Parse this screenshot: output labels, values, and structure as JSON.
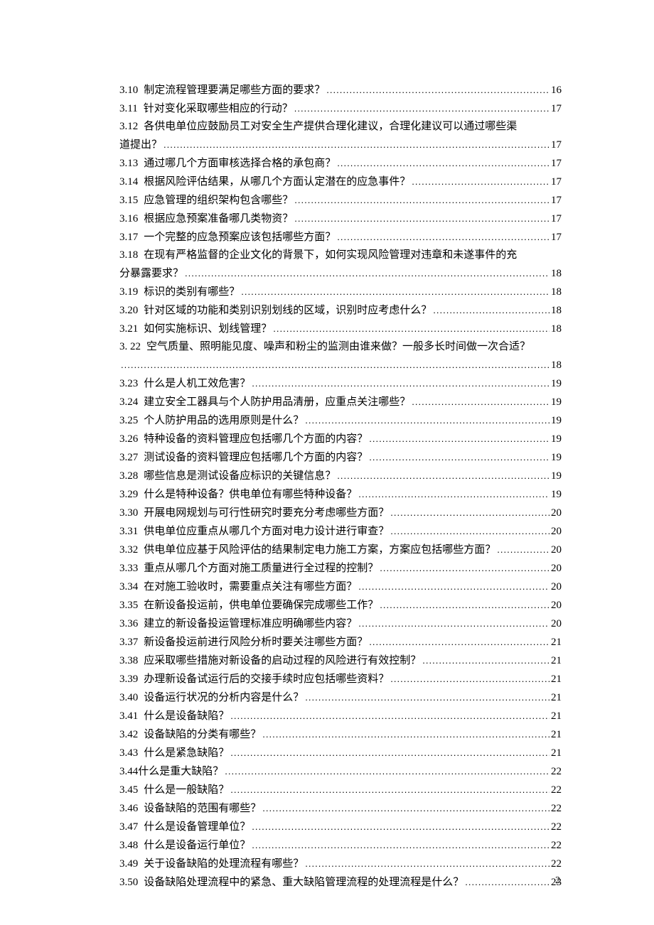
{
  "page_number": "2",
  "entries": [
    {
      "num": "3.10",
      "title": "制定流程管理要满足哪些方面的要求？",
      "page": "16",
      "wrap": false
    },
    {
      "num": "3.11",
      "title": "针对变化采取哪些相应的行动？",
      "page": "17",
      "wrap": false
    },
    {
      "num": "3.12",
      "title_line1": "各供电单位应鼓励员工对安全生产提供合理化建议，合理化建议可以通过哪些渠",
      "title_line2": "道提出？",
      "page": "17",
      "wrap": true
    },
    {
      "num": "3.13",
      "title": "通过哪几个方面审核选择合格的承包商？",
      "page": "17",
      "wrap": false
    },
    {
      "num": "3.14",
      "title": "根据风险评估结果，从哪几个方面认定潜在的应急事件？",
      "page": "17",
      "wrap": false
    },
    {
      "num": "3.15",
      "title": "应急管理的组织架构包含哪些？",
      "page": "17",
      "wrap": false
    },
    {
      "num": "3.16",
      "title": "根据应急预案准备哪几类物资？",
      "page": "17",
      "wrap": false
    },
    {
      "num": "3.17",
      "title": "一个完整的应急预案应该包括哪些方面？",
      "page": "17",
      "wrap": false
    },
    {
      "num": "3.18",
      "title_line1": "在现有严格监督的企业文化的背景下，如何实现风险管理对违章和未遂事件的充",
      "title_line2": "分暴露要求？",
      "page": "18",
      "wrap": true
    },
    {
      "num": "3.19",
      "title": "标识的类别有哪些？",
      "page": "18",
      "wrap": false
    },
    {
      "num": "3.20",
      "title": "针对区域的功能和类别识别划线的区域，识别时应考虑什么？",
      "page": "18",
      "wrap": false
    },
    {
      "num": "3.21",
      "title": "如何实施标识、划线管理？",
      "page": "18",
      "wrap": false
    },
    {
      "num": "3. 22",
      "title_line1": "空气质量、照明能见度、噪声和粉尘的监测由谁来做？一般多长时间做一次合适？",
      "title_line2": "",
      "page": "18",
      "wrap": true
    },
    {
      "num": "3.23",
      "title": "什么是人机工效危害？",
      "page": "19",
      "wrap": false
    },
    {
      "num": "3.24",
      "title": "建立安全工器具与个人防护用品清册，应重点关注哪些？",
      "page": "19",
      "wrap": false
    },
    {
      "num": "3.25",
      "title": "个人防护用品的选用原则是什么？",
      "page": "19",
      "wrap": false
    },
    {
      "num": "3.26",
      "title": "特种设备的资料管理应包括哪几个方面的内容？",
      "page": "19",
      "wrap": false
    },
    {
      "num": "3.27",
      "title": "测试设备的资料管理应包括哪几个方面的内容？",
      "page": "19",
      "wrap": false
    },
    {
      "num": "3.28",
      "title": "哪些信息是测试设备应标识的关键信息？",
      "page": "19",
      "wrap": false
    },
    {
      "num": "3.29",
      "title": "什么是特种设备？供电单位有哪些特种设备？",
      "page": "19",
      "wrap": false
    },
    {
      "num": "3.30",
      "title": "开展电网规划与可行性研究时要充分考虑哪些方面？",
      "page": "20",
      "wrap": false
    },
    {
      "num": "3.31",
      "title": "供电单位应重点从哪几个方面对电力设计进行审查？",
      "page": "20",
      "wrap": false
    },
    {
      "num": "3.32",
      "title": "供电单位应基于风险评估的结果制定电力施工方案，方案应包括哪些方面？",
      "page": "20",
      "wrap": false,
      "tight": true
    },
    {
      "num": "3.33",
      "title": "重点从哪几个方面对施工质量进行全过程的控制？",
      "page": "20",
      "wrap": false
    },
    {
      "num": "3.34",
      "title": "在对施工验收时，需要重点关注有哪些方面？",
      "page": "20",
      "wrap": false
    },
    {
      "num": "3.35",
      "title": "在新设备投运前，供电单位要确保完成哪些工作？",
      "page": "20",
      "wrap": false
    },
    {
      "num": "3.36",
      "title": "建立的新设备投运管理标准应明确哪些内容？",
      "page": "20",
      "wrap": false
    },
    {
      "num": "3.37",
      "title": "新设备投运前进行风险分析时要关注哪些方面？",
      "page": "21",
      "wrap": false
    },
    {
      "num": "3.38",
      "title": "应采取哪些措施对新设备的启动过程的风险进行有效控制？",
      "page": "21",
      "wrap": false
    },
    {
      "num": "3.39",
      "title": "办理新设备试运行后的交接手续时应包括哪些资料？",
      "page": "21",
      "wrap": false
    },
    {
      "num": "3.40",
      "title": "设备运行状况的分析内容是什么？",
      "page": "21",
      "wrap": false
    },
    {
      "num": "3.41",
      "title": "什么是设备缺陷？",
      "page": "21",
      "wrap": false
    },
    {
      "num": "3.42",
      "title": "设备缺陷的分类有哪些？",
      "page": "21",
      "wrap": false
    },
    {
      "num": "3.43",
      "title": "什么是紧急缺陷？",
      "page": "21",
      "wrap": false
    },
    {
      "num": "3.44",
      "title": "什么是重大缺陷？",
      "page": "22",
      "wrap": false,
      "nogap": true
    },
    {
      "num": "3.45",
      "title": "什么是一般缺陷？",
      "page": "22",
      "wrap": false
    },
    {
      "num": "3.46",
      "title": "设备缺陷的范围有哪些？",
      "page": "22",
      "wrap": false
    },
    {
      "num": "3.47",
      "title": "什么是设备管理单位？",
      "page": "22",
      "wrap": false
    },
    {
      "num": "3.48",
      "title": "什么是设备运行单位？",
      "page": "22",
      "wrap": false
    },
    {
      "num": "3.49",
      "title": "关于设备缺陷的处理流程有哪些？",
      "page": "22",
      "wrap": false
    },
    {
      "num": "3.50",
      "title": "设备缺陷处理流程中的紧急、重大缺陷管理流程的处理流程是什么？",
      "page": "23",
      "wrap": false
    }
  ]
}
